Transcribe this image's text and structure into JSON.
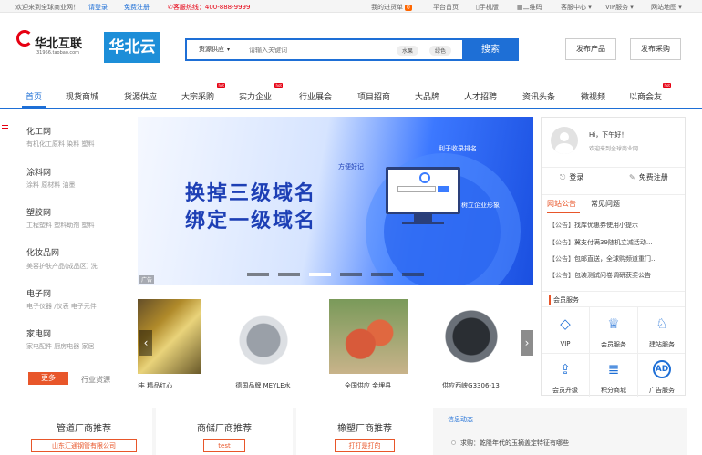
{
  "topbar": {
    "welcome": "欢迎来到全球商业网！",
    "login": "请登录",
    "register": "免费注册",
    "hotline": "客服热线：400-888-9999",
    "cart": "我的进货单",
    "cart_count": "0",
    "links": [
      "平台首页",
      "手机版",
      "二维码",
      "客服中心",
      "VIP服务",
      "网站地图"
    ]
  },
  "header": {
    "logo_text": "华北互联",
    "logo_sub": "31966.taobao.com",
    "logo_cloud": "华北云",
    "search_category": "资源供应",
    "search_placeholder": "请输入关键词",
    "search_tags": [
      "水果",
      "绿色"
    ],
    "search_button": "搜索",
    "publish_product": "发布产品",
    "publish_purchase": "发布采购"
  },
  "nav": {
    "items": [
      "首页",
      "现货商城",
      "货源供应",
      "大宗采购",
      "实力企业",
      "行业展会",
      "项目招商",
      "大品牌",
      "人才招聘",
      "资讯头条",
      "微视频",
      "以商会友"
    ],
    "hot_label": "hot"
  },
  "left_menu": {
    "categories": [
      {
        "title": "化工网",
        "subs": "有机化工原料  染料  塑料"
      },
      {
        "title": "涂料网",
        "subs": "涂料  原材料  油墨"
      },
      {
        "title": "塑胶网",
        "subs": "工程塑料  塑料助剂  塑料"
      },
      {
        "title": "化妆品网",
        "subs": "美容护肤产品(成品区)  洗"
      },
      {
        "title": "电子网",
        "subs": "电子仪器 /仪表  电子元件"
      },
      {
        "title": "家电网",
        "subs": "家电配件  厨房电器  家居"
      }
    ],
    "more_button": "更多",
    "more_text": "行业货源"
  },
  "banner": {
    "line1": "换掉三级域名",
    "line2": "绑定一级域名",
    "note1": "方便好记",
    "note2": "利于收录排名",
    "note3": "树立企业形象",
    "ad_label": "广告",
    "slide_count": 6,
    "active_slide": 3
  },
  "products": [
    {
      "caption": "隆丰 精品红心"
    },
    {
      "caption": "德国品牌 MEYLE水"
    },
    {
      "caption": "全国供应 金埋县"
    },
    {
      "caption": "供应西峡G3306-13"
    }
  ],
  "right_panel": {
    "greeting": "Hi，下午好！",
    "greeting_sub": "欢迎来到全球商业网",
    "login": "登录",
    "register": "免费注册",
    "tabs": [
      "网站公告",
      "常见问题"
    ],
    "notices": [
      {
        "tag": "【公告】",
        "text": "找库优惠券使用小提示"
      },
      {
        "tag": "【公告】",
        "text": "冀支付满39随机立减活动..."
      },
      {
        "tag": "【公告】",
        "text": "包邮直送，全球购频道重门..."
      },
      {
        "tag": "【公告】",
        "text": "包装测试问卷调研获奖公告"
      }
    ],
    "services_title": "会员服务",
    "services": [
      "VIP",
      "会员服务",
      "建站服务",
      "会员升级",
      "积分商城",
      "广告服务"
    ]
  },
  "bottom": {
    "recs": [
      {
        "title": "管道厂商推荐",
        "tag": "山东汇通钢管有限公司"
      },
      {
        "title": "商储厂商推荐",
        "tag": "test"
      },
      {
        "title": "橡塑厂商推荐",
        "tag": "打打是打的"
      }
    ],
    "news_title": "信息动态",
    "news": [
      "求购：乾隆年代的玉摘盖定特征有哪些"
    ]
  }
}
